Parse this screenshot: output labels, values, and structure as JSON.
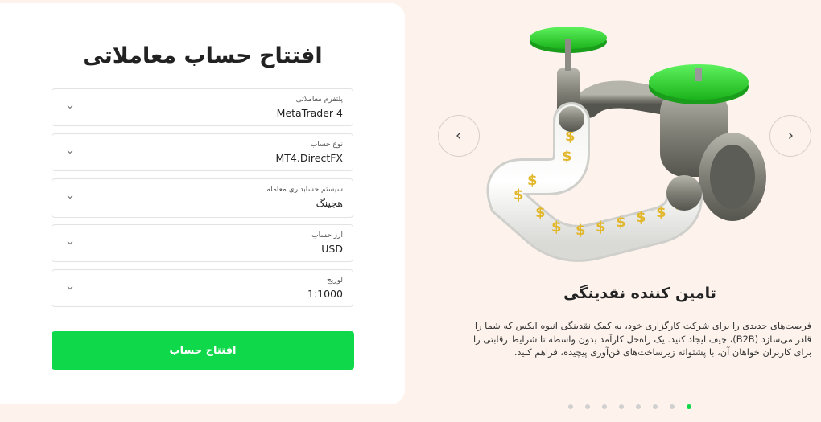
{
  "form": {
    "title": "افتتاح حساب معاملاتی",
    "fields": [
      {
        "label": "پلتفرم معاملاتی",
        "value": "MetaTrader 4"
      },
      {
        "label": "نوع حساب",
        "value": "MT4.DirectFX"
      },
      {
        "label": "سیستم حسابداری معامله",
        "value": "هجینگ"
      },
      {
        "label": "ارز حساب",
        "value": "USD"
      },
      {
        "label": "لوریج",
        "value": "1:1000"
      }
    ],
    "submit_label": "افتتاح حساب"
  },
  "carousel": {
    "prev_icon": "chevron-left-icon",
    "next_icon": "chevron-right-icon",
    "slide_title": "تامین کننده نقدینگی",
    "slide_description": "فرصت‌های جدیدی را برای شرکت کارگزاری خود، به کمک نقدینگی انبوه ایکس که شما را قادر می‌سازد (B2B)، چیف ایجاد کنید. یک راه‌حل کارآمد بدون واسطه تا شرایط رقابتی را برای کاربران خواهان آن، با پشتوانه زیرساخت‌های فن‌آوری پیچیده، فراهم کنید.",
    "dot_count": 8,
    "active_dot": 7
  },
  "colors": {
    "accent": "#0fd84a",
    "background": "#fdf3ec",
    "card": "#ffffff",
    "valve_green": "#2ed62e",
    "pipe_metal": "#8a8a80",
    "coin_gold": "#e2b72c"
  }
}
